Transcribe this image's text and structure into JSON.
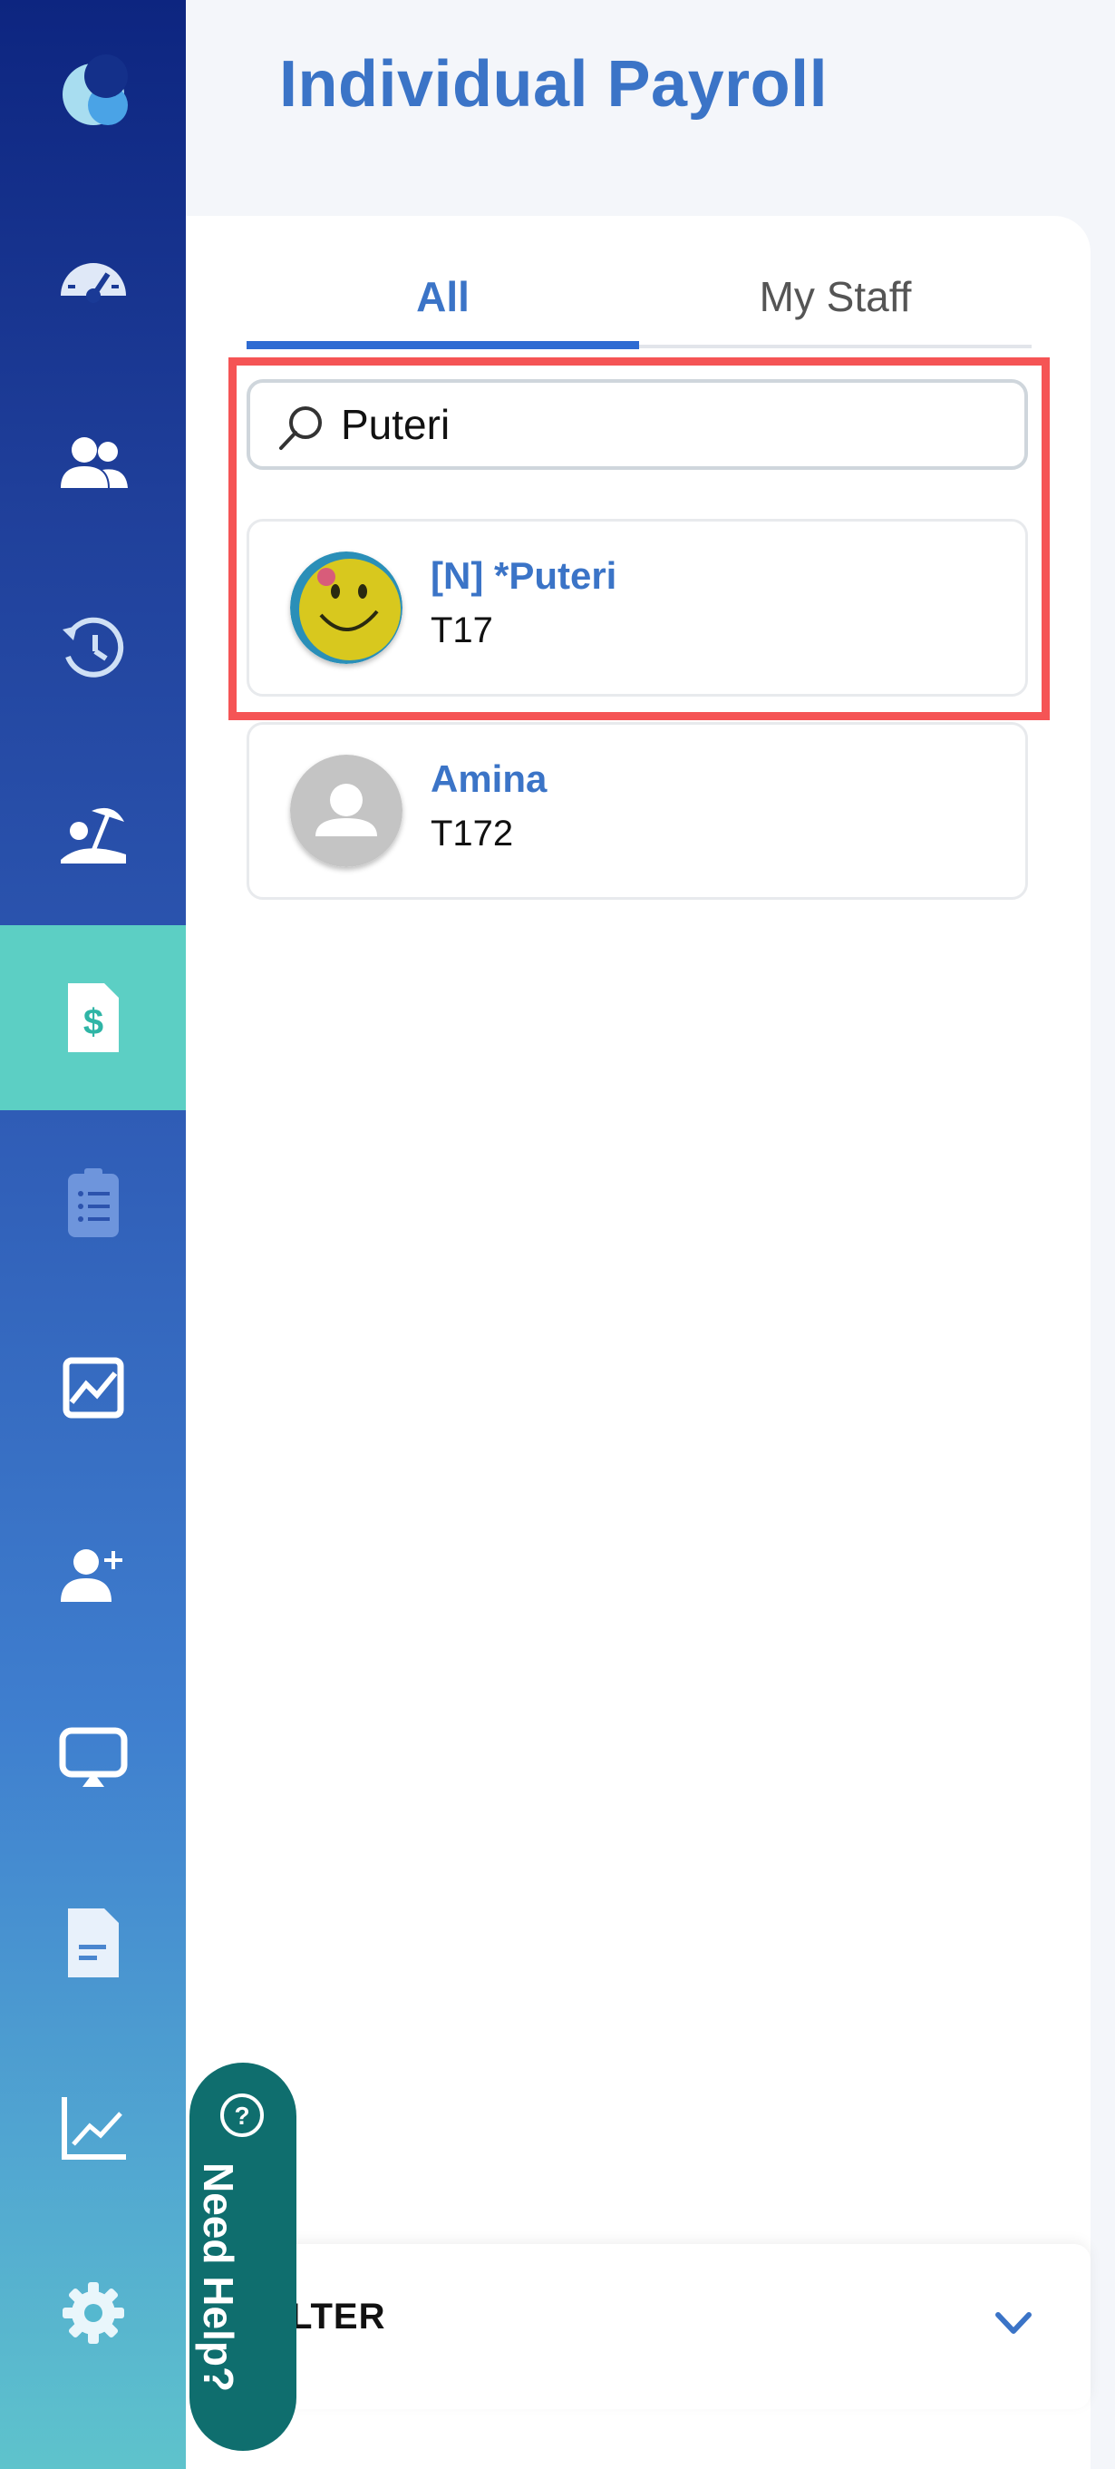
{
  "page": {
    "title": "Individual Payroll"
  },
  "tabs": {
    "all": "All",
    "my_staff": "My Staff"
  },
  "search": {
    "value": "Puteri",
    "icon": "search-icon"
  },
  "staff": [
    {
      "name": "[N] *Puteri",
      "id": "T17",
      "avatar": "photo",
      "highlighted": true
    },
    {
      "name": "Amina",
      "id": "T172",
      "avatar": "placeholder"
    }
  ],
  "filter": {
    "label": "LTER"
  },
  "help": {
    "label": "Need Help?"
  },
  "sidebar": {
    "items": [
      {
        "icon": "moon-logo-icon"
      },
      {
        "icon": "dashboard-gauge-icon"
      },
      {
        "icon": "people-icon"
      },
      {
        "icon": "attendance-history-icon"
      },
      {
        "icon": "leave-beach-icon"
      },
      {
        "icon": "payroll-dollar-icon",
        "active": true
      },
      {
        "icon": "clipboard-list-icon"
      },
      {
        "icon": "analytics-chart-icon"
      },
      {
        "icon": "add-user-icon"
      },
      {
        "icon": "screen-cast-icon"
      },
      {
        "icon": "document-icon"
      },
      {
        "icon": "line-chart-icon"
      },
      {
        "icon": "settings-gear-icon"
      }
    ]
  },
  "colors": {
    "accent": "#3b74c7",
    "active_nav": "#5ccfc4",
    "highlight": "#f55455",
    "help": "#0f6e6e"
  }
}
